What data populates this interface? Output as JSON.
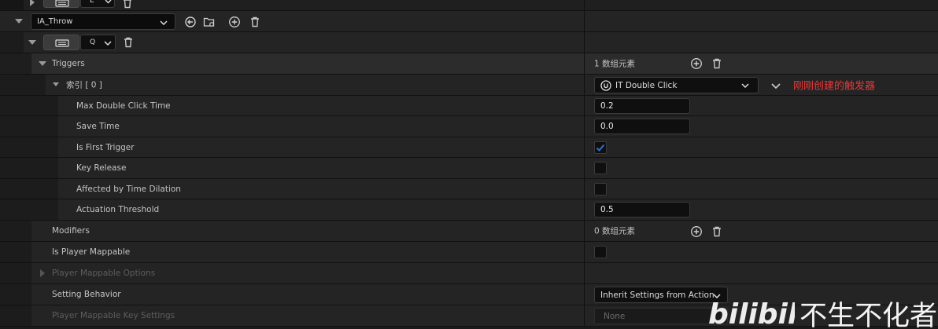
{
  "action_row": {
    "name_value": "IA_Throw"
  },
  "key_row": {
    "top_key_value": "E",
    "key_value": "Q"
  },
  "triggers": {
    "label": "Triggers",
    "count_text": "1 数组元素"
  },
  "index_row": {
    "label": "索引 [ 0 ]",
    "trigger_type": "IT Double Click",
    "annotation": "刚刚创建的触发器"
  },
  "properties": [
    {
      "label": "Max Double Click Time",
      "value": "0.2"
    },
    {
      "label": "Save Time",
      "value": "0.0"
    },
    {
      "label": "Is First Trigger",
      "checked": true
    },
    {
      "label": "Key Release",
      "checked": false
    },
    {
      "label": "Affected by Time Dilation",
      "checked": false
    },
    {
      "label": "Actuation Threshold",
      "value": "0.5"
    }
  ],
  "modifiers": {
    "label": "Modifiers",
    "count_text": "0 数组元素"
  },
  "player_mappable": {
    "label": "Is Player Mappable",
    "checked": false
  },
  "player_mappable_options": {
    "label": "Player Mappable Options"
  },
  "setting_behavior": {
    "label": "Setting Behavior",
    "value": "Inherit Settings from Action"
  },
  "player_mappable_key_settings": {
    "label": "Player Mappable Key Settings",
    "value": "None"
  },
  "watermark": {
    "text": "不生不化者",
    "logo": "bilibili"
  },
  "colors": {
    "accent": "#2f6fd6",
    "annotation": "#e83a3a"
  }
}
